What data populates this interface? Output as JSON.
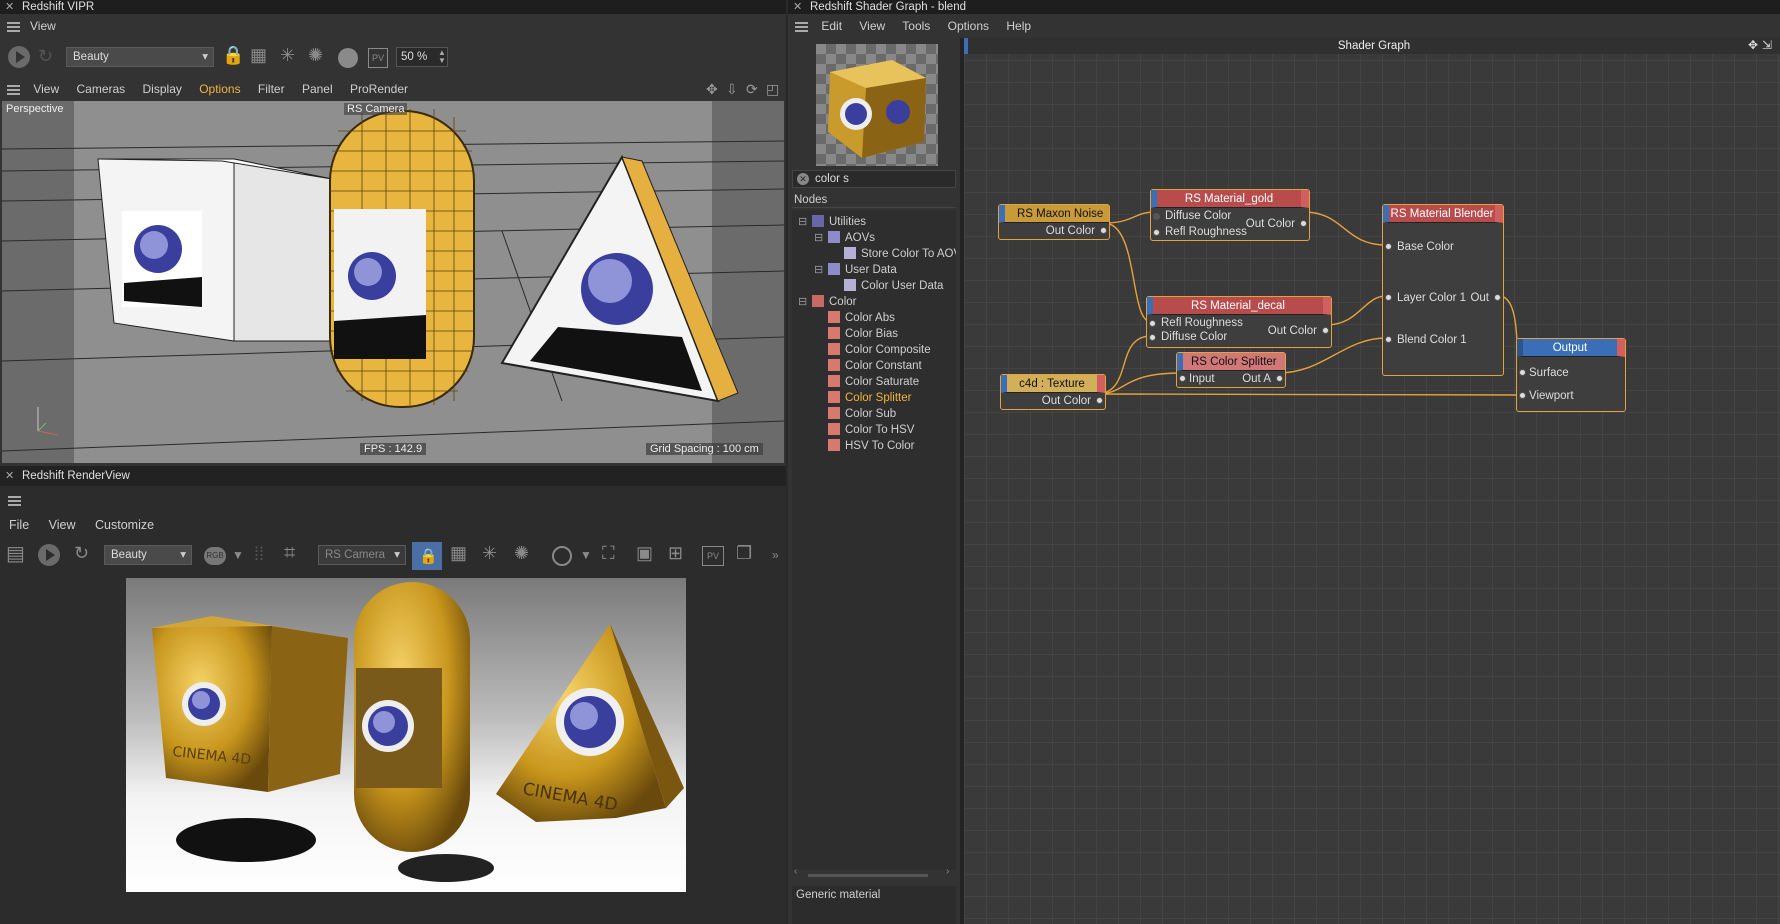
{
  "vipr": {
    "title": "Redshift VIPR",
    "menu": [
      "View"
    ],
    "aov": "Beauty",
    "zoom": "50 %",
    "view_menu": [
      "View",
      "Cameras",
      "Display",
      "Options",
      "Filter",
      "Panel",
      "ProRender"
    ],
    "viewport_label": "Perspective",
    "camera_label": "RS Camera",
    "fps": "FPS : 142.9",
    "grid": "Grid Spacing : 100 cm"
  },
  "renderview": {
    "title": "Redshift RenderView",
    "menu": [
      "File",
      "View",
      "Customize"
    ],
    "aov": "Beauty",
    "camera": "RS Camera",
    "text_cube": "CINEMA 4D",
    "text_pyramid": "CINEMA 4D"
  },
  "shader": {
    "title": "Redshift Shader Graph - blend",
    "menu": [
      "Edit",
      "View",
      "Tools",
      "Options",
      "Help"
    ],
    "search": "color s",
    "nodes_label": "Nodes",
    "graph_title": "Shader Graph",
    "description": "Generic material",
    "tree": [
      {
        "label": "Utilities",
        "indent": 0,
        "color": "#6a64a8",
        "toggle": "⊟"
      },
      {
        "label": "AOVs",
        "indent": 1,
        "color": "#8f8ac8",
        "toggle": "⊟"
      },
      {
        "label": "Store Color To AOV",
        "indent": 2,
        "color": "#b4b0d8",
        "toggle": ""
      },
      {
        "label": "User Data",
        "indent": 1,
        "color": "#8f8ac8",
        "toggle": "⊟"
      },
      {
        "label": "Color User Data",
        "indent": 2,
        "color": "#b4b0d8",
        "toggle": ""
      },
      {
        "label": "Color",
        "indent": 0,
        "color": "#c86a64",
        "toggle": "⊟"
      },
      {
        "label": "Color Abs",
        "indent": 1,
        "color": "#d9786f",
        "toggle": ""
      },
      {
        "label": "Color Bias",
        "indent": 1,
        "color": "#d9786f",
        "toggle": ""
      },
      {
        "label": "Color Composite",
        "indent": 1,
        "color": "#d9786f",
        "toggle": ""
      },
      {
        "label": "Color Constant",
        "indent": 1,
        "color": "#d9786f",
        "toggle": ""
      },
      {
        "label": "Color Saturate",
        "indent": 1,
        "color": "#d9786f",
        "toggle": ""
      },
      {
        "label": "Color Splitter",
        "indent": 1,
        "color": "#d9786f",
        "toggle": "",
        "active": true
      },
      {
        "label": "Color Sub",
        "indent": 1,
        "color": "#d9786f",
        "toggle": ""
      },
      {
        "label": "Color To HSV",
        "indent": 1,
        "color": "#d9786f",
        "toggle": ""
      },
      {
        "label": "HSV To Color",
        "indent": 1,
        "color": "#d9786f",
        "toggle": ""
      }
    ],
    "nodes": {
      "maxon_noise": {
        "title": "RS Maxon Noise",
        "out": "Out Color"
      },
      "gold": {
        "title": "RS Material_gold",
        "in1": "Diffuse Color",
        "in2": "Refl Roughness",
        "out": "Out Color"
      },
      "blender": {
        "title": "RS Material Blender",
        "in1": "Base Color",
        "in2": "Layer Color 1",
        "in3": "Blend Color 1",
        "out": "Out"
      },
      "decal": {
        "title": "RS Material_decal",
        "in1": "Refl Roughness",
        "in2": "Diffuse Color",
        "out": "Out Color"
      },
      "splitter": {
        "title": "RS Color Splitter",
        "in": "Input",
        "out": "Out A"
      },
      "texture": {
        "title": "c4d : Texture",
        "out": "Out Color"
      },
      "output": {
        "title": "Output",
        "in1": "Surface",
        "in2": "Viewport"
      }
    }
  }
}
